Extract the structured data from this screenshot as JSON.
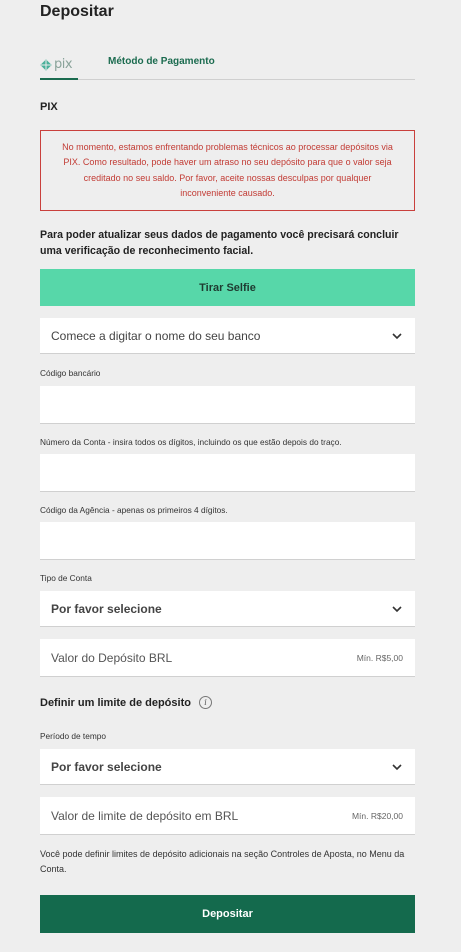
{
  "page": {
    "title": "Depositar"
  },
  "tabs": {
    "pix_logo_text": "pix",
    "method_label": "Método de Pagamento"
  },
  "section": {
    "title": "PIX"
  },
  "alert": {
    "message": "No momento, estamos enfrentando problemas técnicos ao processar depósitos via PIX. Como resultado, pode haver um atraso no seu depósito para que o valor seja creditado no seu saldo. Por favor, aceite nossas desculpas por qualquer inconveniente causado.",
    "color": "#c23b34"
  },
  "verification": {
    "text": "Para poder atualizar seus dados de pagamento você precisará concluir uma verificação de reconhecimento facial.",
    "button_label": "Tirar Selfie",
    "button_color": "#57d7a9"
  },
  "bank": {
    "placeholder": "Comece a digitar o nome do seu banco",
    "icon": "chevron-down-icon"
  },
  "bank_code": {
    "label": "Código bancário",
    "value": ""
  },
  "account_number": {
    "label": "Número da Conta - insira todos os dígitos, incluindo os que estão depois do traço.",
    "value": ""
  },
  "agency_code": {
    "label": "Código da Agência - apenas os primeiros 4 dígitos.",
    "value": ""
  },
  "account_type": {
    "label": "Tipo de Conta",
    "selected": "Por favor selecione"
  },
  "deposit_amount": {
    "placeholder": "Valor do Depósito BRL",
    "min": "Mín. R$5,00"
  },
  "limit": {
    "heading": "Definir um limite de depósito",
    "info_icon": "info-icon",
    "period_label": "Período de tempo",
    "period_selected": "Por favor selecione",
    "amount_placeholder": "Valor de limite de depósito em BRL",
    "min": "Mín. R$20,00"
  },
  "note": "Você pode definir limites de depósito adicionais na seção Controles de Aposta, no Menu da Conta.",
  "submit": {
    "label": "Depositar",
    "color": "#146a4d"
  }
}
